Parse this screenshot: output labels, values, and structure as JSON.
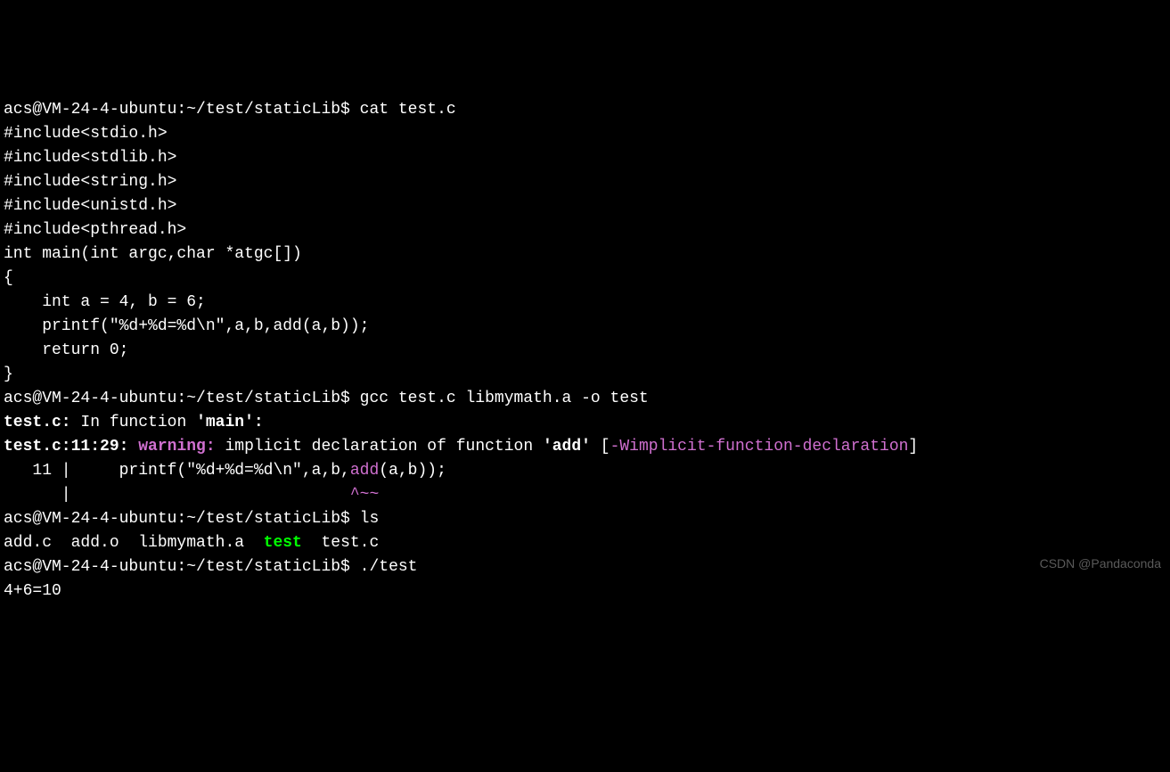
{
  "lines": {
    "l1_prompt": "acs@VM-24-4-ubuntu:~/test/staticLib$ ",
    "l1_cmd": "cat test.c",
    "l2": "#include<stdio.h>",
    "l3": "#include<stdlib.h>",
    "l4": "#include<string.h>",
    "l5": "#include<unistd.h>",
    "l6": "#include<pthread.h>",
    "l7": "",
    "l8": "int main(int argc,char *atgc[])",
    "l9": "{",
    "l10": "    int a = 4, b = 6;",
    "l11": "",
    "l12": "    printf(\"%d+%d=%d\\n\",a,b,add(a,b));",
    "l13": "",
    "l14": "    return 0;",
    "l15": "}",
    "l16_prompt": "acs@VM-24-4-ubuntu:~/test/staticLib$ ",
    "l16_cmd": "gcc test.c libmymath.a -o test",
    "l17_a": "test.c:",
    "l17_b": " In function ",
    "l17_c": "'main'",
    "l17_d": ":",
    "l18_a": "test.c:11:29:",
    "l18_b": " ",
    "l18_c": "warning: ",
    "l18_d": "implicit declaration of function ",
    "l18_e": "'add'",
    "l18_f": " [",
    "l18_g": "-Wimplicit-function-declaration",
    "l18_h": "]",
    "l19_a": "   11 |     printf(\"%d+%d=%d\\n\",a,b,",
    "l19_b": "add",
    "l19_c": "(a,b));",
    "l20_a": "      |                             ",
    "l20_b": "^~~",
    "l21_prompt": "acs@VM-24-4-ubuntu:~/test/staticLib$ ",
    "l21_cmd": "ls",
    "l22_a": "add.c  add.o  libmymath.a  ",
    "l22_b": "test",
    "l22_c": "  test.c",
    "l23_prompt": "acs@VM-24-4-ubuntu:~/test/staticLib$ ",
    "l23_cmd": "./test",
    "l24": "4+6=10"
  },
  "watermark": "CSDN @Pandaconda"
}
